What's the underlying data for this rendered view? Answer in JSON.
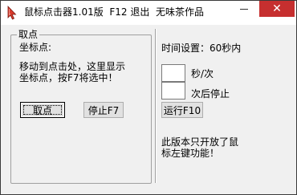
{
  "window": {
    "title": "鼠标点击器1.01版  F12 退出  无味茶作品",
    "close_label": "✕",
    "minimize_label": ""
  },
  "left_panel": {
    "group_title": "取点",
    "coord_label": "坐标点:",
    "instruction_line1": "移动到点击处，这里显示",
    "instruction_line2": "坐标点，按F7将选中！",
    "pick_button": "取点",
    "stop_button": "停止F7"
  },
  "right_panel": {
    "time_setting": "时间设置：60秒内",
    "interval_value": "",
    "interval_unit": "秒/次",
    "stop_after_value": "",
    "stop_after_unit": "次后停止",
    "run_button": "运行F10",
    "note_line1": "此版本只开放了鼠",
    "note_line2": "标左键功能！"
  },
  "colors": {
    "close_button": "#c62f2f",
    "window_bg": "#f0f0f0",
    "icon_red": "#d93a2b"
  }
}
